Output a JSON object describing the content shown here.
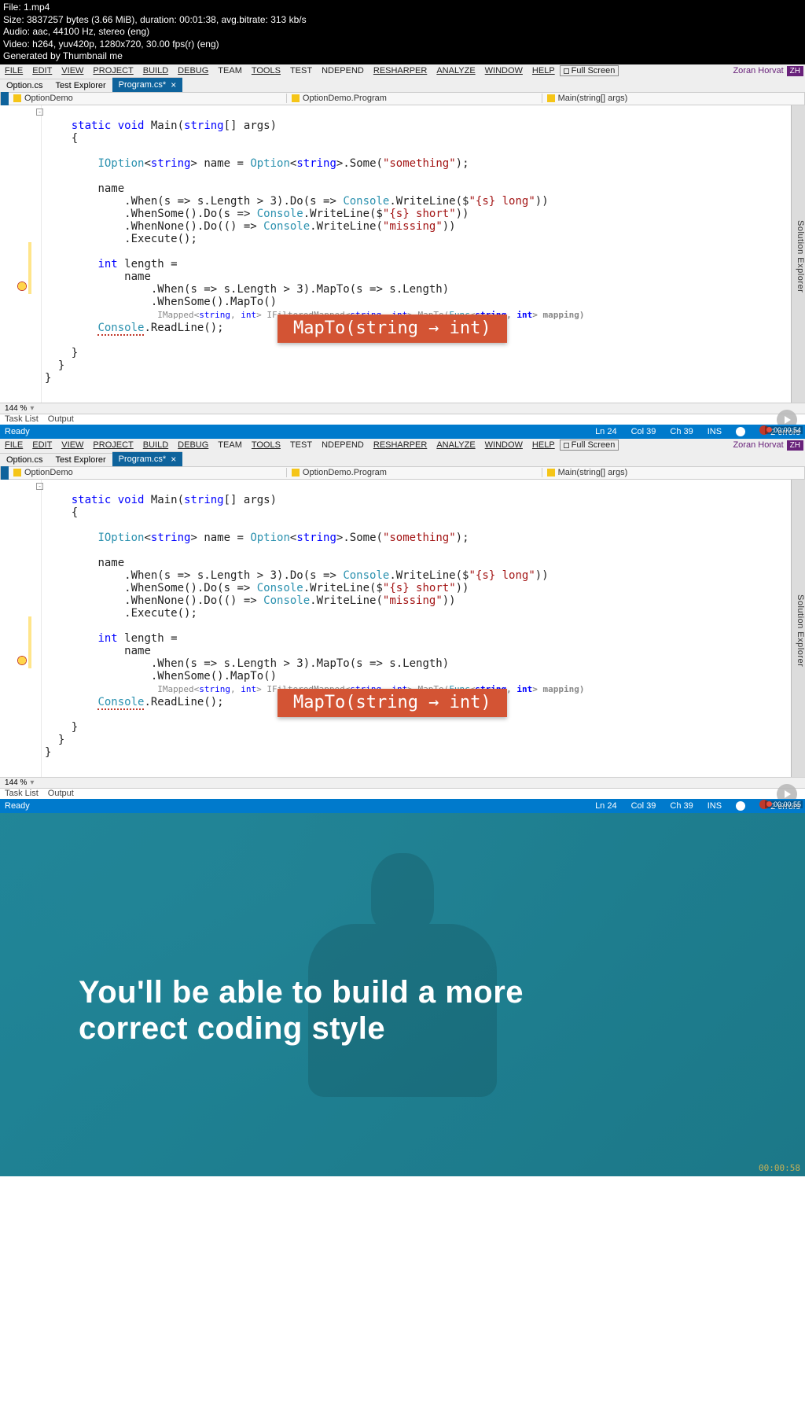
{
  "filemeta": {
    "l1": "File: 1.mp4",
    "l2": "Size: 3837257 bytes (3.66 MiB), duration: 00:01:38, avg.bitrate: 313 kb/s",
    "l3": "Audio: aac, 44100 Hz, stereo (eng)",
    "l4": "Video: h264, yuv420p, 1280x720, 30.00 fps(r) (eng)",
    "l5": "Generated by Thumbnail me"
  },
  "menu": {
    "file": "FILE",
    "edit": "EDIT",
    "view": "VIEW",
    "project": "PROJECT",
    "build": "BUILD",
    "debug": "DEBUG",
    "team": "TEAM",
    "tools": "TOOLS",
    "test": "TEST",
    "ndepend": "NDEPEND",
    "resharper": "RESHARPER",
    "analyze": "ANALYZE",
    "window": "WINDOW",
    "help": "HELP",
    "fullscreen": "Full Screen",
    "user": "Zoran Horvat",
    "vtag": "ZH"
  },
  "tabs": {
    "t1": "Option.cs",
    "t2": "Test Explorer",
    "t3": "Program.cs*"
  },
  "nav": {
    "proj": "OptionDemo",
    "ns": "OptionDemo.Program",
    "member": "Main(string[] args)"
  },
  "sidepanel": "Solution Explorer",
  "zoom": "144 %",
  "bottomtabs": {
    "tasklist": "Task List",
    "output": "Output"
  },
  "status": {
    "ready": "Ready",
    "ln": "Ln 24",
    "col": "Col 39",
    "ch": "Ch 39",
    "ins": "INS",
    "errors": "2 errors",
    "rec1": "00:00:54",
    "rec2": "00:00:55"
  },
  "code": {
    "sig_static": "static",
    "sig_void": "void",
    "sig_main": " Main(",
    "sig_string": "string",
    "sig_args": "[] args)",
    "decl_iopt": "IOption",
    "decl_str": "string",
    "decl_name_eq": "> name = ",
    "decl_option": "Option",
    "decl_some": ">.Some(",
    "decl_lit": "\"something\"",
    "decl_end": ");",
    "name": "name",
    "when_a": "    .When(s => s.Length > 3).Do(s => ",
    "console": "Console",
    "wl_long": ".WriteLine($",
    "lit_long": "\"{s} long\"",
    "paren2": "))",
    "whensome": "    .WhenSome().Do(s => ",
    "lit_short": "\"{s} short\"",
    "whennone": "    .WhenNone().Do(() => ",
    "wl_plain": ".WriteLine(",
    "lit_missing": "\"missing\"",
    "execute": "    .Execute();",
    "int": "int",
    "length_eq": " length =",
    "when_map": "        .When(s => s.Length > 3).MapTo(s => s.Length)",
    "whensome_map": "        .WhenSome().MapTo()",
    "hint_pre": "IMapped<",
    "hint_s": "string",
    "hint_c": ", ",
    "hint_i": "int",
    "hint_ifm": "> IFilteredMapped<",
    "hint_map": ">.MapTo(",
    "hint_func": "Func",
    "hint_lt": "<",
    "hint_gt": ">",
    "hint_mapping": " mapping)",
    "readline": ".ReadLine();",
    "brace_o": "{",
    "brace_c": "}"
  },
  "callout": "MapTo(string → int)",
  "promo": {
    "line1": "You'll be able to build a more",
    "line2": "correct coding style",
    "ts": "00:00:58"
  }
}
